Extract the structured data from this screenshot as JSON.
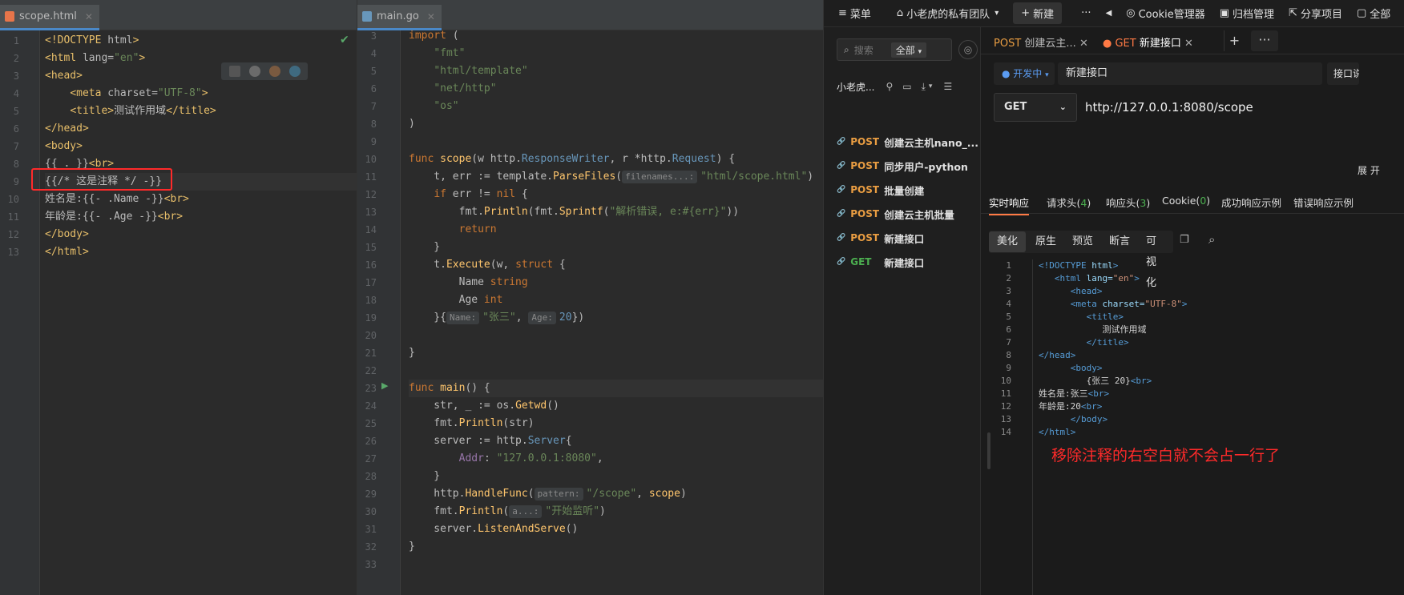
{
  "html_editor": {
    "tab_label": "scope.html",
    "lines": [
      {
        "n": "1",
        "parts": [
          [
            "tag",
            "<!DOCTYPE "
          ],
          [
            "attr",
            "html"
          ],
          [
            "tag",
            ">"
          ]
        ]
      },
      {
        "n": "2",
        "parts": [
          [
            "tag",
            "<html "
          ],
          [
            "attr",
            "lang="
          ],
          [
            "str",
            "\"en\""
          ],
          [
            "tag",
            ">"
          ]
        ]
      },
      {
        "n": "3",
        "parts": [
          [
            "tag",
            "<head>"
          ]
        ]
      },
      {
        "n": "4",
        "parts": [
          [
            "plain",
            "    "
          ],
          [
            "tag",
            "<meta "
          ],
          [
            "attr",
            "charset="
          ],
          [
            "str",
            "\"UTF-8\""
          ],
          [
            "tag",
            ">"
          ]
        ]
      },
      {
        "n": "5",
        "parts": [
          [
            "plain",
            "    "
          ],
          [
            "tag",
            "<title>"
          ],
          [
            "plain",
            "测试作用域"
          ],
          [
            "tag",
            "</title>"
          ]
        ]
      },
      {
        "n": "6",
        "parts": [
          [
            "tag",
            "</head>"
          ]
        ]
      },
      {
        "n": "7",
        "parts": [
          [
            "tag",
            "<body>"
          ]
        ]
      },
      {
        "n": "8",
        "parts": [
          [
            "plain",
            "{{ . }}"
          ],
          [
            "tag",
            "<br>"
          ]
        ]
      },
      {
        "n": "9",
        "parts": [
          [
            "plain",
            "{{/* 这是注释 */ -}}"
          ]
        ]
      },
      {
        "n": "10",
        "parts": [
          [
            "plain",
            "姓名是:{{- .Name -}}"
          ],
          [
            "tag",
            "<br>"
          ]
        ]
      },
      {
        "n": "11",
        "parts": [
          [
            "plain",
            "年龄是:{{- .Age -}}"
          ],
          [
            "tag",
            "<br>"
          ]
        ]
      },
      {
        "n": "12",
        "parts": [
          [
            "tag",
            "</body>"
          ]
        ]
      },
      {
        "n": "13",
        "parts": [
          [
            "tag",
            "</html>"
          ]
        ]
      }
    ]
  },
  "go_editor": {
    "tab_label": "main.go",
    "lines": [
      {
        "n": "3",
        "parts": [
          [
            "kw",
            "import"
          ],
          [
            "plain",
            " ("
          ]
        ]
      },
      {
        "n": "4",
        "parts": [
          [
            "plain",
            "    "
          ],
          [
            "str",
            "\"fmt\""
          ]
        ]
      },
      {
        "n": "5",
        "parts": [
          [
            "plain",
            "    "
          ],
          [
            "str",
            "\"html/template\""
          ]
        ]
      },
      {
        "n": "6",
        "parts": [
          [
            "plain",
            "    "
          ],
          [
            "str",
            "\"net/http\""
          ]
        ]
      },
      {
        "n": "7",
        "parts": [
          [
            "plain",
            "    "
          ],
          [
            "str",
            "\"os\""
          ]
        ]
      },
      {
        "n": "8",
        "parts": [
          [
            "plain",
            ")"
          ]
        ]
      },
      {
        "n": "9",
        "parts": []
      },
      {
        "n": "10",
        "parts": [
          [
            "kw",
            "func "
          ],
          [
            "fn",
            "scope"
          ],
          [
            "plain",
            "(w http."
          ],
          [
            "type",
            "ResponseWriter"
          ],
          [
            "plain",
            ", r *http."
          ],
          [
            "type",
            "Request"
          ],
          [
            "plain",
            ") {"
          ]
        ]
      },
      {
        "n": "11",
        "parts": [
          [
            "plain",
            "    t, err := template."
          ],
          [
            "fn",
            "ParseFiles"
          ],
          [
            "plain",
            "("
          ],
          [
            "hint",
            "filenames...:"
          ],
          [
            "str",
            "\"html/scope.html\""
          ],
          [
            "plain",
            ")"
          ]
        ]
      },
      {
        "n": "12",
        "parts": [
          [
            "plain",
            "    "
          ],
          [
            "kw",
            "if "
          ],
          [
            "plain",
            "err != "
          ],
          [
            "kw",
            "nil"
          ],
          [
            "plain",
            " {"
          ]
        ]
      },
      {
        "n": "13",
        "parts": [
          [
            "plain",
            "        fmt."
          ],
          [
            "fn",
            "Println"
          ],
          [
            "plain",
            "(fmt."
          ],
          [
            "fn",
            "Sprintf"
          ],
          [
            "plain",
            "("
          ],
          [
            "str",
            "\"解析错误, e:#{err}\""
          ],
          [
            "plain",
            "))"
          ]
        ]
      },
      {
        "n": "14",
        "parts": [
          [
            "plain",
            "        "
          ],
          [
            "kw",
            "return"
          ]
        ]
      },
      {
        "n": "15",
        "parts": [
          [
            "plain",
            "    }"
          ]
        ]
      },
      {
        "n": "16",
        "parts": [
          [
            "plain",
            "    t."
          ],
          [
            "fn",
            "Execute"
          ],
          [
            "plain",
            "(w, "
          ],
          [
            "kw",
            "struct"
          ],
          [
            "plain",
            " {"
          ]
        ]
      },
      {
        "n": "17",
        "parts": [
          [
            "plain",
            "        Name "
          ],
          [
            "kw",
            "string"
          ]
        ]
      },
      {
        "n": "18",
        "parts": [
          [
            "plain",
            "        Age "
          ],
          [
            "kw",
            "int"
          ]
        ]
      },
      {
        "n": "19",
        "parts": [
          [
            "plain",
            "    }{"
          ],
          [
            "hint",
            "Name:"
          ],
          [
            "str",
            "\"张三\""
          ],
          [
            "plain",
            ", "
          ],
          [
            "hint",
            "Age:"
          ],
          [
            "type",
            "20"
          ],
          [
            "plain",
            "})"
          ]
        ]
      },
      {
        "n": "20",
        "parts": []
      },
      {
        "n": "21",
        "parts": [
          [
            "plain",
            "}"
          ]
        ]
      },
      {
        "n": "22",
        "parts": []
      },
      {
        "n": "23",
        "parts": [
          [
            "kw",
            "func "
          ],
          [
            "fn",
            "main"
          ],
          [
            "plain",
            "() {"
          ]
        ]
      },
      {
        "n": "24",
        "parts": [
          [
            "plain",
            "    str, _ := os."
          ],
          [
            "fn",
            "Getwd"
          ],
          [
            "plain",
            "()"
          ]
        ]
      },
      {
        "n": "25",
        "parts": [
          [
            "plain",
            "    fmt."
          ],
          [
            "fn",
            "Println"
          ],
          [
            "plain",
            "(str)"
          ]
        ]
      },
      {
        "n": "26",
        "parts": [
          [
            "plain",
            "    server := http."
          ],
          [
            "type",
            "Server"
          ],
          [
            "plain",
            "{"
          ]
        ]
      },
      {
        "n": "27",
        "parts": [
          [
            "plain",
            "        "
          ],
          [
            "field",
            "Addr"
          ],
          [
            "plain",
            ": "
          ],
          [
            "str",
            "\"127.0.0.1:8080\""
          ],
          [
            "plain",
            ","
          ]
        ]
      },
      {
        "n": "28",
        "parts": [
          [
            "plain",
            "    }"
          ]
        ]
      },
      {
        "n": "29",
        "parts": [
          [
            "plain",
            "    http."
          ],
          [
            "fn",
            "HandleFunc"
          ],
          [
            "plain",
            "("
          ],
          [
            "hint",
            "pattern:"
          ],
          [
            "str",
            "\"/scope\""
          ],
          [
            "plain",
            ", "
          ],
          [
            "fn",
            "scope"
          ],
          [
            "plain",
            ")"
          ]
        ]
      },
      {
        "n": "30",
        "parts": [
          [
            "plain",
            "    fmt."
          ],
          [
            "fn",
            "Println"
          ],
          [
            "plain",
            "("
          ],
          [
            "hint",
            "a...:"
          ],
          [
            "str",
            "\"开始监听\""
          ],
          [
            "plain",
            ")"
          ]
        ]
      },
      {
        "n": "31",
        "parts": [
          [
            "plain",
            "    server."
          ],
          [
            "fn",
            "ListenAndServe"
          ],
          [
            "plain",
            "()"
          ]
        ]
      },
      {
        "n": "32",
        "parts": [
          [
            "plain",
            "}"
          ]
        ]
      },
      {
        "n": "33",
        "parts": []
      }
    ]
  },
  "api_app": {
    "topbar": {
      "menu": "菜单",
      "team": "小老虎的私有团队",
      "new_button": "新建",
      "cookie_manager": "Cookie管理器",
      "archive": "归档管理",
      "share": "分享项目",
      "full": "全部"
    },
    "sidebar": {
      "search_placeholder": "搜索",
      "filter_select": "全部",
      "project_name": "小老虎...",
      "requests": [
        {
          "method": "POST",
          "name": "创建云主机nano_..."
        },
        {
          "method": "POST",
          "name": "同步用户-python"
        },
        {
          "method": "POST",
          "name": "批量创建"
        },
        {
          "method": "POST",
          "name": "创建云主机批量"
        },
        {
          "method": "POST",
          "name": "新建接口"
        },
        {
          "method": "GET",
          "name": "新建接口"
        }
      ]
    },
    "tabs": [
      {
        "method": "POST",
        "label": "创建云主..."
      },
      {
        "method": "GET",
        "label": "新建接口"
      }
    ],
    "status_select": "开发中",
    "request_name": "新建接口",
    "doc_button": "接口说",
    "method_select": "GET",
    "url": "http://127.0.0.1:8080/scope",
    "expand_label": "展 开",
    "response_tabs": [
      "实时响应",
      "请求头(",
      "响应头(",
      "Cookie(",
      "成功响应示例",
      "错误响应示例"
    ],
    "response_counts": {
      "req_headers": "4",
      "resp_headers": "3",
      "cookies": "0"
    },
    "view_modes": [
      "美化",
      "原生",
      "预览",
      "断言",
      "可视化"
    ],
    "response_lines": [
      {
        "n": "1",
        "parts": [
          [
            "tag",
            "<!DOCTYPE "
          ],
          [
            "attr",
            "html"
          ],
          [
            "tag",
            ">"
          ]
        ]
      },
      {
        "n": "2",
        "parts": [
          [
            "plain",
            "   "
          ],
          [
            "tag",
            "<html "
          ],
          [
            "attr",
            "lang="
          ],
          [
            "str",
            "\"en\""
          ],
          [
            "tag",
            ">"
          ]
        ]
      },
      {
        "n": "3",
        "parts": [
          [
            "plain",
            "      "
          ],
          [
            "tag",
            "<head>"
          ]
        ]
      },
      {
        "n": "4",
        "parts": [
          [
            "plain",
            "      "
          ],
          [
            "tag",
            "<meta "
          ],
          [
            "attr",
            "charset="
          ],
          [
            "str",
            "\"UTF-8\""
          ],
          [
            "tag",
            ">"
          ]
        ]
      },
      {
        "n": "5",
        "parts": [
          [
            "plain",
            "         "
          ],
          [
            "tag",
            "<title>"
          ]
        ]
      },
      {
        "n": "6",
        "parts": [
          [
            "plain",
            "            测试作用域"
          ]
        ]
      },
      {
        "n": "7",
        "parts": [
          [
            "plain",
            "         "
          ],
          [
            "tag",
            "</title>"
          ]
        ]
      },
      {
        "n": "8",
        "parts": [
          [
            "tag",
            "</head>"
          ]
        ]
      },
      {
        "n": "9",
        "parts": [
          [
            "plain",
            "      "
          ],
          [
            "tag",
            "<body>"
          ]
        ]
      },
      {
        "n": "10",
        "parts": [
          [
            "plain",
            "         {张三 20}"
          ],
          [
            "tag",
            "<br>"
          ]
        ]
      },
      {
        "n": "11",
        "parts": [
          [
            "plain",
            "姓名是:张三"
          ],
          [
            "tag",
            "<br>"
          ]
        ]
      },
      {
        "n": "12",
        "parts": [
          [
            "plain",
            "年龄是:20"
          ],
          [
            "tag",
            "<br>"
          ]
        ]
      },
      {
        "n": "13",
        "parts": [
          [
            "plain",
            "      "
          ],
          [
            "tag",
            "</body>"
          ]
        ]
      },
      {
        "n": "14",
        "parts": [
          [
            "tag",
            "</html>"
          ]
        ]
      }
    ],
    "annotation": "移除注释的右空白就不会占一行了"
  },
  "colors": {
    "accent": "#4a88c7",
    "post": "#e99d42",
    "get": "#4caf50",
    "annotation_red": "#ff2a2a",
    "active_tab": "#ff7a45"
  }
}
